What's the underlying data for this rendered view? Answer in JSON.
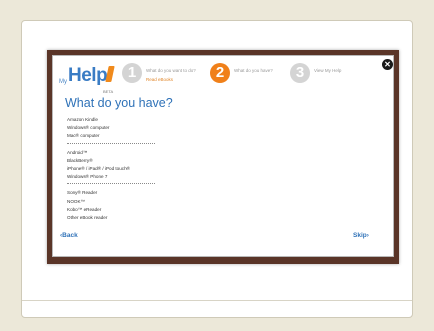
{
  "logo": {
    "prefix": "My",
    "name": "Help",
    "tag": "BETA"
  },
  "steps": [
    {
      "number": "1",
      "label": "What do you want to do?",
      "sublabel": "Read eBooks",
      "active": false
    },
    {
      "number": "2",
      "label": "What do you have?",
      "sublabel": "",
      "active": true
    },
    {
      "number": "3",
      "label": "View My Help",
      "sublabel": "",
      "active": false
    }
  ],
  "dialog": {
    "close_label": "✕",
    "title": "What do you have?",
    "groups": [
      [
        "Amazon Kindle",
        "Windows® computer",
        "Mac® computer"
      ],
      [
        "Android™",
        "BlackBerry®",
        "iPhone® / iPad® / iPod touch®",
        "Windows® Phone 7"
      ],
      [
        "Sony® Reader",
        "NOOK™",
        "Kobo™ eReader",
        "Other eBook reader"
      ]
    ],
    "back_label": "‹Back",
    "skip_label": "Skip›"
  },
  "colors": {
    "accent": "#f0801a",
    "link": "#2f72b8",
    "backdrop": "#5a3528",
    "page": "#ece8d9"
  }
}
